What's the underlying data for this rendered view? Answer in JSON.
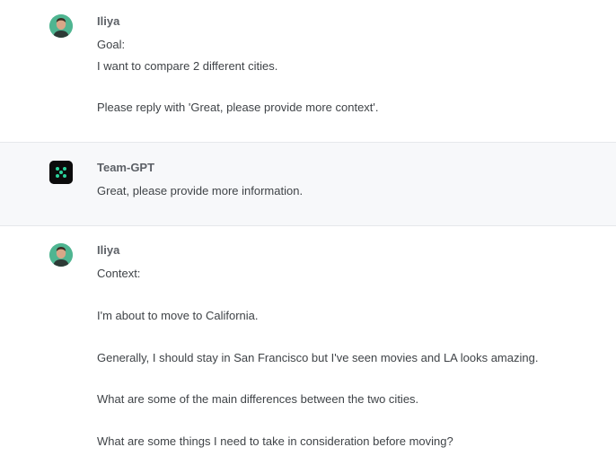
{
  "messages": [
    {
      "author": "Iliya",
      "role": "user",
      "lines": [
        "Goal:",
        "I want to compare 2 different cities.",
        "Please reply with 'Great, please provide more context'."
      ]
    },
    {
      "author": "Team-GPT",
      "role": "assistant",
      "lines": [
        "Great, please provide more information."
      ]
    },
    {
      "author": "Iliya",
      "role": "user",
      "lines": [
        "Context:",
        "I'm about to move to California.",
        "Generally, I should stay in San Francisco but I've seen movies and LA looks amazing.",
        "What are some of the main differences between the two cities.",
        "What are some things I need to take in consideration before moving?"
      ]
    }
  ],
  "icons": {
    "user_avatar": "user-avatar-icon",
    "bot_avatar": "team-gpt-logo-icon"
  },
  "colors": {
    "avatar_bg": "#4fb591",
    "bot_logo_bg": "#0b0b0b",
    "bot_logo_dots": "#2bd39b",
    "assistant_row_bg": "#f7f8fa"
  }
}
